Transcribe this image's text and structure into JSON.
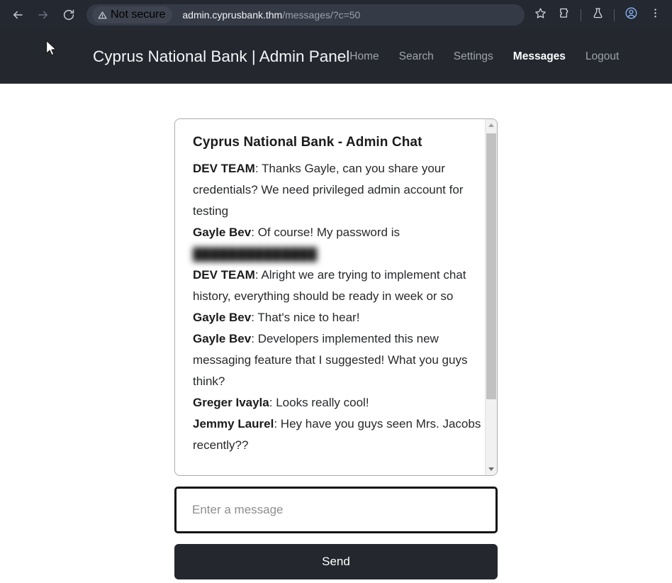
{
  "browser": {
    "back_label": "Back",
    "forward_label": "Forward",
    "reload_label": "Reload",
    "security_status": "Not secure",
    "url_host": "admin.cyprusbank.thm",
    "url_path": "/messages/?c=50",
    "bookmark_label": "Bookmark this tab",
    "extensions_label": "Extensions",
    "labs_label": "Experiments",
    "profile_label": "Profile",
    "menu_label": "Customize and control"
  },
  "site_header": {
    "brand": "Cyprus National Bank | Admin Panel",
    "nav": [
      {
        "label": "Home",
        "active": false
      },
      {
        "label": "Search",
        "active": false
      },
      {
        "label": "Settings",
        "active": false
      },
      {
        "label": "Messages",
        "active": true
      },
      {
        "label": "Logout",
        "active": false
      }
    ]
  },
  "chat": {
    "heading": "Cyprus National Bank - Admin Chat",
    "messages": [
      {
        "sender": "DEV TEAM",
        "text": "Thanks Gayle, can you share your credentials? We need privileged admin account for testing",
        "redacted": false
      },
      {
        "sender": "Gayle Bev",
        "text": "Of course! My password is",
        "redacted": true,
        "redacted_text": "██████████████"
      },
      {
        "sender": "DEV TEAM",
        "text": "Alright we are trying to implement chat history, everything should be ready in week or so",
        "redacted": false
      },
      {
        "sender": "Gayle Bev",
        "text": "That's nice to hear!",
        "redacted": false
      },
      {
        "sender": "Gayle Bev",
        "text": "Developers implemented this new messaging feature that I suggested! What you guys think?",
        "redacted": false
      },
      {
        "sender": "Greger Ivayla",
        "text": "Looks really cool!",
        "redacted": false
      },
      {
        "sender": "Jemmy Laurel",
        "text": "Hey have you guys seen Mrs. Jacobs recently??",
        "redacted": false
      }
    ],
    "scrollbar": {
      "up_label": "Scroll up",
      "down_label": "Scroll down",
      "thumb_label": "Scroll thumb"
    }
  },
  "composer": {
    "placeholder": "Enter a message",
    "value": "",
    "send_label": "Send"
  },
  "colors": {
    "chrome_bg": "#242830",
    "header_bg": "#24282e",
    "accent_profile": "#8ab4f8",
    "text_muted": "#9fa3aa",
    "scroll_thumb": "#c1c1c1"
  }
}
